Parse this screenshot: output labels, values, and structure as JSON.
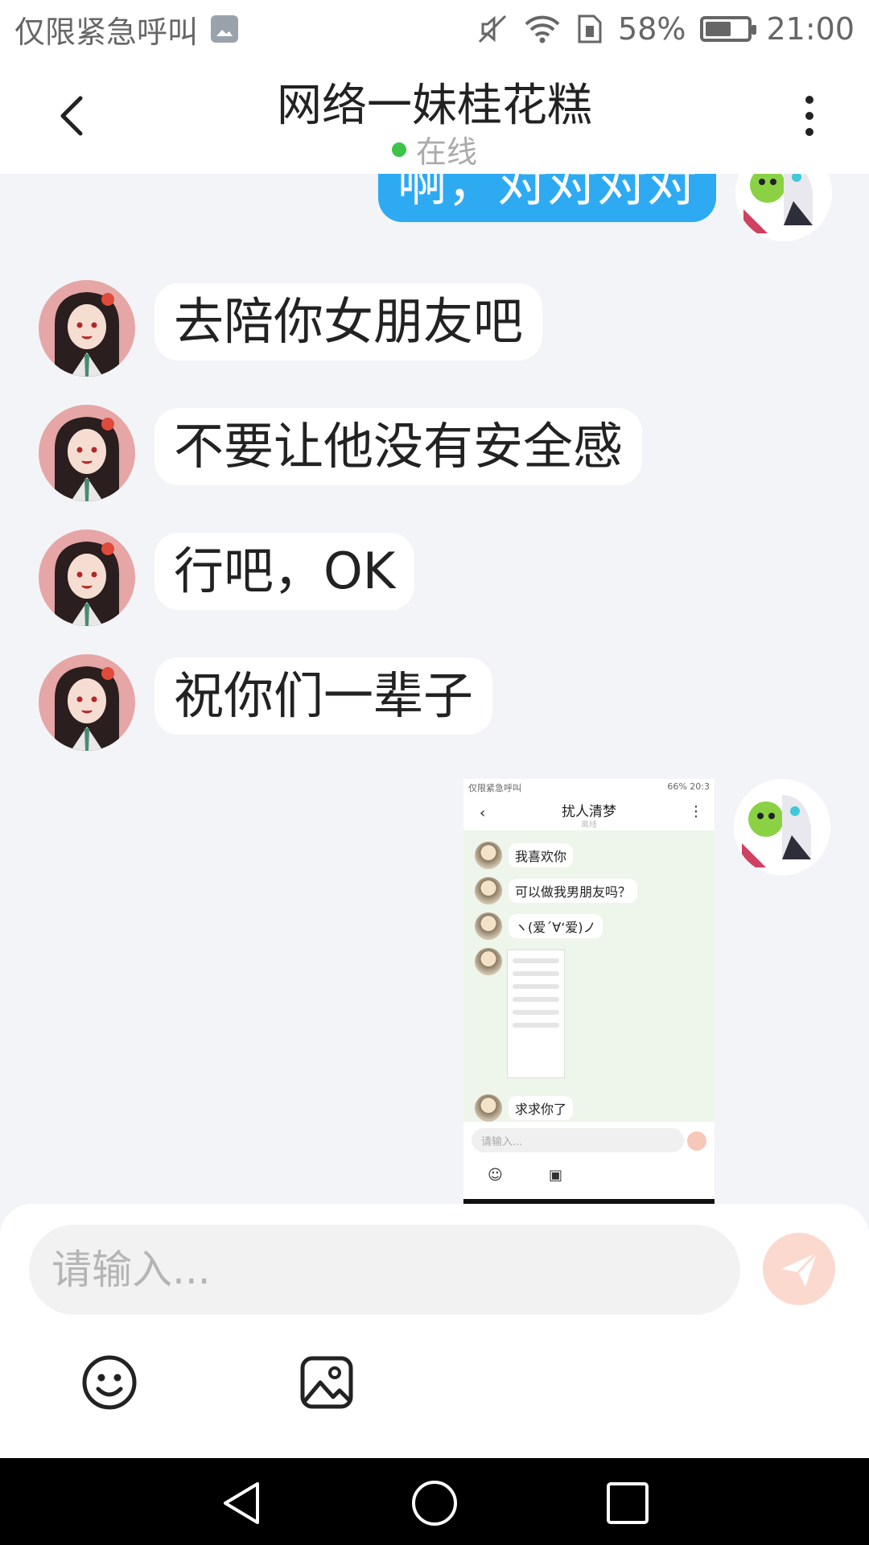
{
  "status_bar": {
    "carrier_text": "仅限紧急呼叫",
    "battery_percent": "58%",
    "battery_level": 0.58,
    "time": "21:00"
  },
  "header": {
    "title": "网络一妹桂花糕",
    "status": "在线"
  },
  "messages": [
    {
      "direction": "out",
      "text": "啊，对对对对"
    },
    {
      "direction": "in",
      "text": "去陪你女朋友吧"
    },
    {
      "direction": "in",
      "text": "不要让他没有安全感"
    },
    {
      "direction": "in",
      "text": "行吧，OK"
    },
    {
      "direction": "in",
      "text": "祝你们一辈子"
    }
  ],
  "image_message": {
    "status_left": "仅限紧急呼叫",
    "status_right": "66% 20:3",
    "title": "扰人清梦",
    "subtitle": "离线",
    "bubbles": [
      "我喜欢你",
      "可以做我男朋友吗？",
      "ヽ(爱´∀‘爱)ノ",
      "求求你了"
    ],
    "input_placeholder": "请输入..."
  },
  "input": {
    "placeholder": "请输入..."
  },
  "colors": {
    "outgoing_bubble": "#2eaaf2",
    "online_dot": "#3cc34a",
    "send_button": "#fbd9cf"
  },
  "icons": [
    "back-arrow-icon",
    "more-vertical-icon",
    "send-icon",
    "emoji-icon",
    "image-icon",
    "nav-back-icon",
    "nav-home-icon",
    "nav-recents-icon"
  ]
}
